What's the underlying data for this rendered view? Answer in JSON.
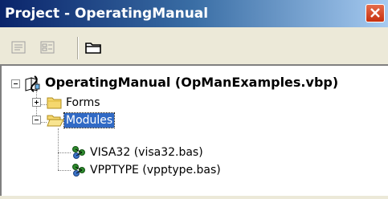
{
  "window": {
    "title": "Project - OperatingManual"
  },
  "toolbar": {
    "buttons": [
      {
        "icon": "view-code-icon"
      },
      {
        "icon": "view-object-icon"
      },
      {
        "icon": "toggle-folders-icon"
      }
    ]
  },
  "tree": {
    "root": {
      "label": "OperatingManual (OpManExamples.vbp)",
      "icon": "vb-project-icon",
      "expanded": true
    },
    "forms": {
      "label": "Forms",
      "icon": "folder-icon",
      "expanded": false
    },
    "modules": {
      "label": "Modules",
      "icon": "open-folder-icon",
      "expanded": true,
      "selected": true
    },
    "module_items": [
      {
        "label": "VISA32 (visa32.bas)",
        "icon": "module-icon"
      },
      {
        "label": "VPPTYPE (vpptype.bas)",
        "icon": "module-icon"
      }
    ]
  },
  "colors": {
    "titlebar_start": "#0a246a",
    "titlebar_end": "#a6caf0",
    "selection": "#316ac5",
    "close_button": "#c6300f"
  }
}
